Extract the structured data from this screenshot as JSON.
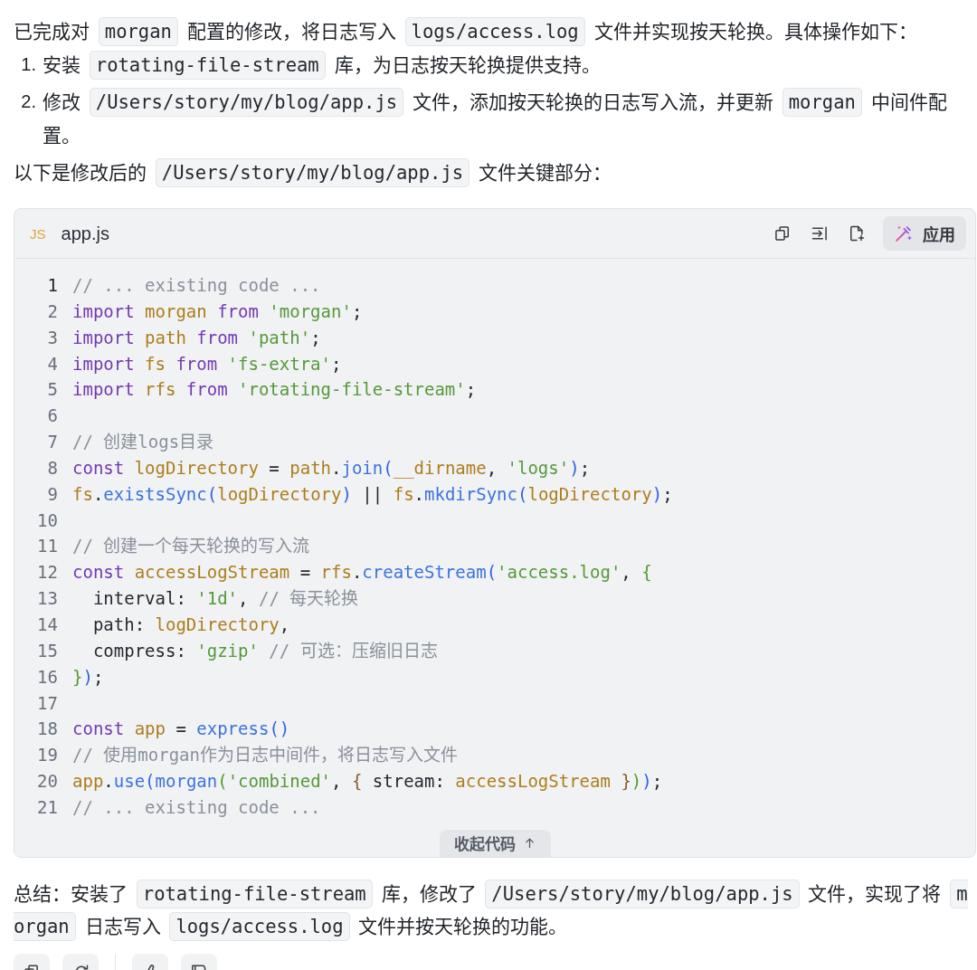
{
  "intro": [
    {
      "kind": "text",
      "text": "已完成对 "
    },
    {
      "kind": "code",
      "text": "morgan"
    },
    {
      "kind": "text",
      "text": " 配置的修改，将日志写入 "
    },
    {
      "kind": "code",
      "text": "logs/access.log"
    },
    {
      "kind": "text",
      "text": " 文件并实现按天轮换。具体操作如下："
    }
  ],
  "steps": [
    {
      "number": "1.",
      "parts": [
        {
          "kind": "text",
          "text": "安装 "
        },
        {
          "kind": "code",
          "text": "rotating-file-stream"
        },
        {
          "kind": "text",
          "text": " 库，为日志按天轮换提供支持。"
        }
      ]
    },
    {
      "number": "2.",
      "parts": [
        {
          "kind": "text",
          "text": "修改 "
        },
        {
          "kind": "code",
          "text": "/Users/story/my/blog/app.js"
        },
        {
          "kind": "text",
          "text": " 文件，添加按天轮换的日志写入流，并更新 "
        },
        {
          "kind": "code",
          "text": "morgan"
        },
        {
          "kind": "text",
          "text": " 中间件配置。"
        }
      ]
    }
  ],
  "lead": [
    {
      "kind": "text",
      "text": "以下是修改后的 "
    },
    {
      "kind": "code",
      "text": "/Users/story/my/blog/app.js"
    },
    {
      "kind": "text",
      "text": " 文件关键部分："
    }
  ],
  "code_block": {
    "badge": "JS",
    "filename": "app.js",
    "tools": [
      {
        "kind": "copy"
      },
      {
        "kind": "insert"
      },
      {
        "kind": "new_file"
      }
    ],
    "apply_button": {
      "label": "应用"
    },
    "lines": [
      {
        "number": "1",
        "current": true,
        "tokens": [
          {
            "kind": "comment",
            "text": "// ... existing code ..."
          }
        ]
      },
      {
        "number": "2",
        "current": false,
        "tokens": [
          {
            "kind": "keyword",
            "text": "import "
          },
          {
            "kind": "name",
            "text": "morgan "
          },
          {
            "kind": "keyword",
            "text": "from "
          },
          {
            "kind": "string",
            "text": "'morgan'"
          },
          {
            "kind": "plain",
            "text": ";"
          }
        ]
      },
      {
        "number": "3",
        "current": false,
        "tokens": [
          {
            "kind": "keyword",
            "text": "import "
          },
          {
            "kind": "name",
            "text": "path "
          },
          {
            "kind": "keyword",
            "text": "from "
          },
          {
            "kind": "string",
            "text": "'path'"
          },
          {
            "kind": "plain",
            "text": ";"
          }
        ]
      },
      {
        "number": "4",
        "current": false,
        "tokens": [
          {
            "kind": "keyword",
            "text": "import "
          },
          {
            "kind": "name",
            "text": "fs "
          },
          {
            "kind": "keyword",
            "text": "from "
          },
          {
            "kind": "string",
            "text": "'fs-extra'"
          },
          {
            "kind": "plain",
            "text": ";"
          }
        ]
      },
      {
        "number": "5",
        "current": false,
        "tokens": [
          {
            "kind": "keyword",
            "text": "import "
          },
          {
            "kind": "name",
            "text": "rfs "
          },
          {
            "kind": "keyword",
            "text": "from "
          },
          {
            "kind": "string",
            "text": "'rotating-file-stream'"
          },
          {
            "kind": "plain",
            "text": ";"
          }
        ]
      },
      {
        "number": "6",
        "current": false
      },
      {
        "number": "7",
        "current": false,
        "tokens": [
          {
            "kind": "comment",
            "text": "// 创建logs目录"
          }
        ]
      },
      {
        "number": "8",
        "current": false,
        "tokens": [
          {
            "kind": "keyword",
            "text": "const "
          },
          {
            "kind": "name",
            "text": "logDirectory"
          },
          {
            "kind": "plain",
            "text": " = "
          },
          {
            "kind": "name",
            "text": "path"
          },
          {
            "kind": "plain",
            "text": "."
          },
          {
            "kind": "func",
            "text": "join"
          },
          {
            "kind": "paren",
            "text": "("
          },
          {
            "kind": "name",
            "text": "__dirname"
          },
          {
            "kind": "plain",
            "text": ", "
          },
          {
            "kind": "string",
            "text": "'logs'"
          },
          {
            "kind": "paren",
            "text": ")"
          },
          {
            "kind": "plain",
            "text": ";"
          }
        ]
      },
      {
        "number": "9",
        "current": false,
        "tokens": [
          {
            "kind": "name",
            "text": "fs"
          },
          {
            "kind": "plain",
            "text": "."
          },
          {
            "kind": "func",
            "text": "existsSync"
          },
          {
            "kind": "paren",
            "text": "("
          },
          {
            "kind": "name",
            "text": "logDirectory"
          },
          {
            "kind": "paren",
            "text": ")"
          },
          {
            "kind": "plain",
            "text": " || "
          },
          {
            "kind": "name",
            "text": "fs"
          },
          {
            "kind": "plain",
            "text": "."
          },
          {
            "kind": "func",
            "text": "mkdirSync"
          },
          {
            "kind": "paren",
            "text": "("
          },
          {
            "kind": "name",
            "text": "logDirectory"
          },
          {
            "kind": "paren",
            "text": ")"
          },
          {
            "kind": "plain",
            "text": ";"
          }
        ]
      },
      {
        "number": "10",
        "current": false
      },
      {
        "number": "11",
        "current": false,
        "tokens": [
          {
            "kind": "comment",
            "text": "// 创建一个每天轮换的写入流"
          }
        ]
      },
      {
        "number": "12",
        "current": false,
        "tokens": [
          {
            "kind": "keyword",
            "text": "const "
          },
          {
            "kind": "name",
            "text": "accessLogStream"
          },
          {
            "kind": "plain",
            "text": " = "
          },
          {
            "kind": "name",
            "text": "rfs"
          },
          {
            "kind": "plain",
            "text": "."
          },
          {
            "kind": "func",
            "text": "createStream"
          },
          {
            "kind": "paren",
            "text": "("
          },
          {
            "kind": "string",
            "text": "'access.log'"
          },
          {
            "kind": "plain",
            "text": ", "
          },
          {
            "kind": "inner",
            "text": "{"
          }
        ]
      },
      {
        "number": "13",
        "current": false,
        "tokens": [
          {
            "kind": "plain",
            "text": "  interval: "
          },
          {
            "kind": "string",
            "text": "'1d'"
          },
          {
            "kind": "plain",
            "text": ", "
          },
          {
            "kind": "comment",
            "text": "// 每天轮换"
          }
        ]
      },
      {
        "number": "14",
        "current": false,
        "tokens": [
          {
            "kind": "plain",
            "text": "  path: "
          },
          {
            "kind": "name",
            "text": "logDirectory"
          },
          {
            "kind": "plain",
            "text": ","
          }
        ]
      },
      {
        "number": "15",
        "current": false,
        "tokens": [
          {
            "kind": "plain",
            "text": "  compress: "
          },
          {
            "kind": "string",
            "text": "'gzip' "
          },
          {
            "kind": "comment",
            "text": "// 可选：压缩旧日志"
          }
        ]
      },
      {
        "number": "16",
        "current": false,
        "tokens": [
          {
            "kind": "inner",
            "text": "}"
          },
          {
            "kind": "paren",
            "text": ")"
          },
          {
            "kind": "plain",
            "text": ";"
          }
        ]
      },
      {
        "number": "17",
        "current": false
      },
      {
        "number": "18",
        "current": false,
        "tokens": [
          {
            "kind": "keyword",
            "text": "const "
          },
          {
            "kind": "name",
            "text": "app"
          },
          {
            "kind": "plain",
            "text": " = "
          },
          {
            "kind": "func",
            "text": "express"
          },
          {
            "kind": "paren",
            "text": "()"
          }
        ]
      },
      {
        "number": "19",
        "current": false,
        "tokens": [
          {
            "kind": "comment",
            "text": "// 使用morgan作为日志中间件，将日志写入文件"
          }
        ]
      },
      {
        "number": "20",
        "current": false,
        "tokens": [
          {
            "kind": "name",
            "text": "app"
          },
          {
            "kind": "plain",
            "text": "."
          },
          {
            "kind": "func",
            "text": "use"
          },
          {
            "kind": "paren",
            "text": "("
          },
          {
            "kind": "func",
            "text": "morgan"
          },
          {
            "kind": "inner",
            "text": "("
          },
          {
            "kind": "string",
            "text": "'combined'"
          },
          {
            "kind": "plain",
            "text": ", "
          },
          {
            "kind": "innermost",
            "text": "{"
          },
          {
            "kind": "plain",
            "text": " stream: "
          },
          {
            "kind": "name",
            "text": "accessLogStream "
          },
          {
            "kind": "innermost",
            "text": "}"
          },
          {
            "kind": "inner",
            "text": ")"
          },
          {
            "kind": "paren",
            "text": ")"
          },
          {
            "kind": "plain",
            "text": ";"
          }
        ]
      },
      {
        "number": "21",
        "current": false,
        "tokens": [
          {
            "kind": "comment",
            "text": "// ... existing code ..."
          }
        ]
      }
    ],
    "collapse_button": {
      "label": "收起代码"
    }
  },
  "summary": [
    {
      "kind": "text",
      "text": "总结：安装了 "
    },
    {
      "kind": "code",
      "text": "rotating-file-stream"
    },
    {
      "kind": "text",
      "text": " 库，修改了 "
    },
    {
      "kind": "code",
      "text": "/Users/story/my/blog/app.js"
    },
    {
      "kind": "text",
      "text": " 文件，实现了将 "
    },
    {
      "kind": "code",
      "text": "morgan"
    },
    {
      "kind": "text",
      "text": " 日志写入 "
    },
    {
      "kind": "code",
      "text": "logs/access.log"
    },
    {
      "kind": "text",
      "text": " 文件并按天轮换的功能。"
    }
  ],
  "action_groups": [
    {
      "buttons": [
        {
          "kind": "copy"
        },
        {
          "kind": "regenerate"
        }
      ]
    },
    {
      "buttons": [
        {
          "kind": "like"
        },
        {
          "kind": "dislike"
        }
      ]
    }
  ]
}
